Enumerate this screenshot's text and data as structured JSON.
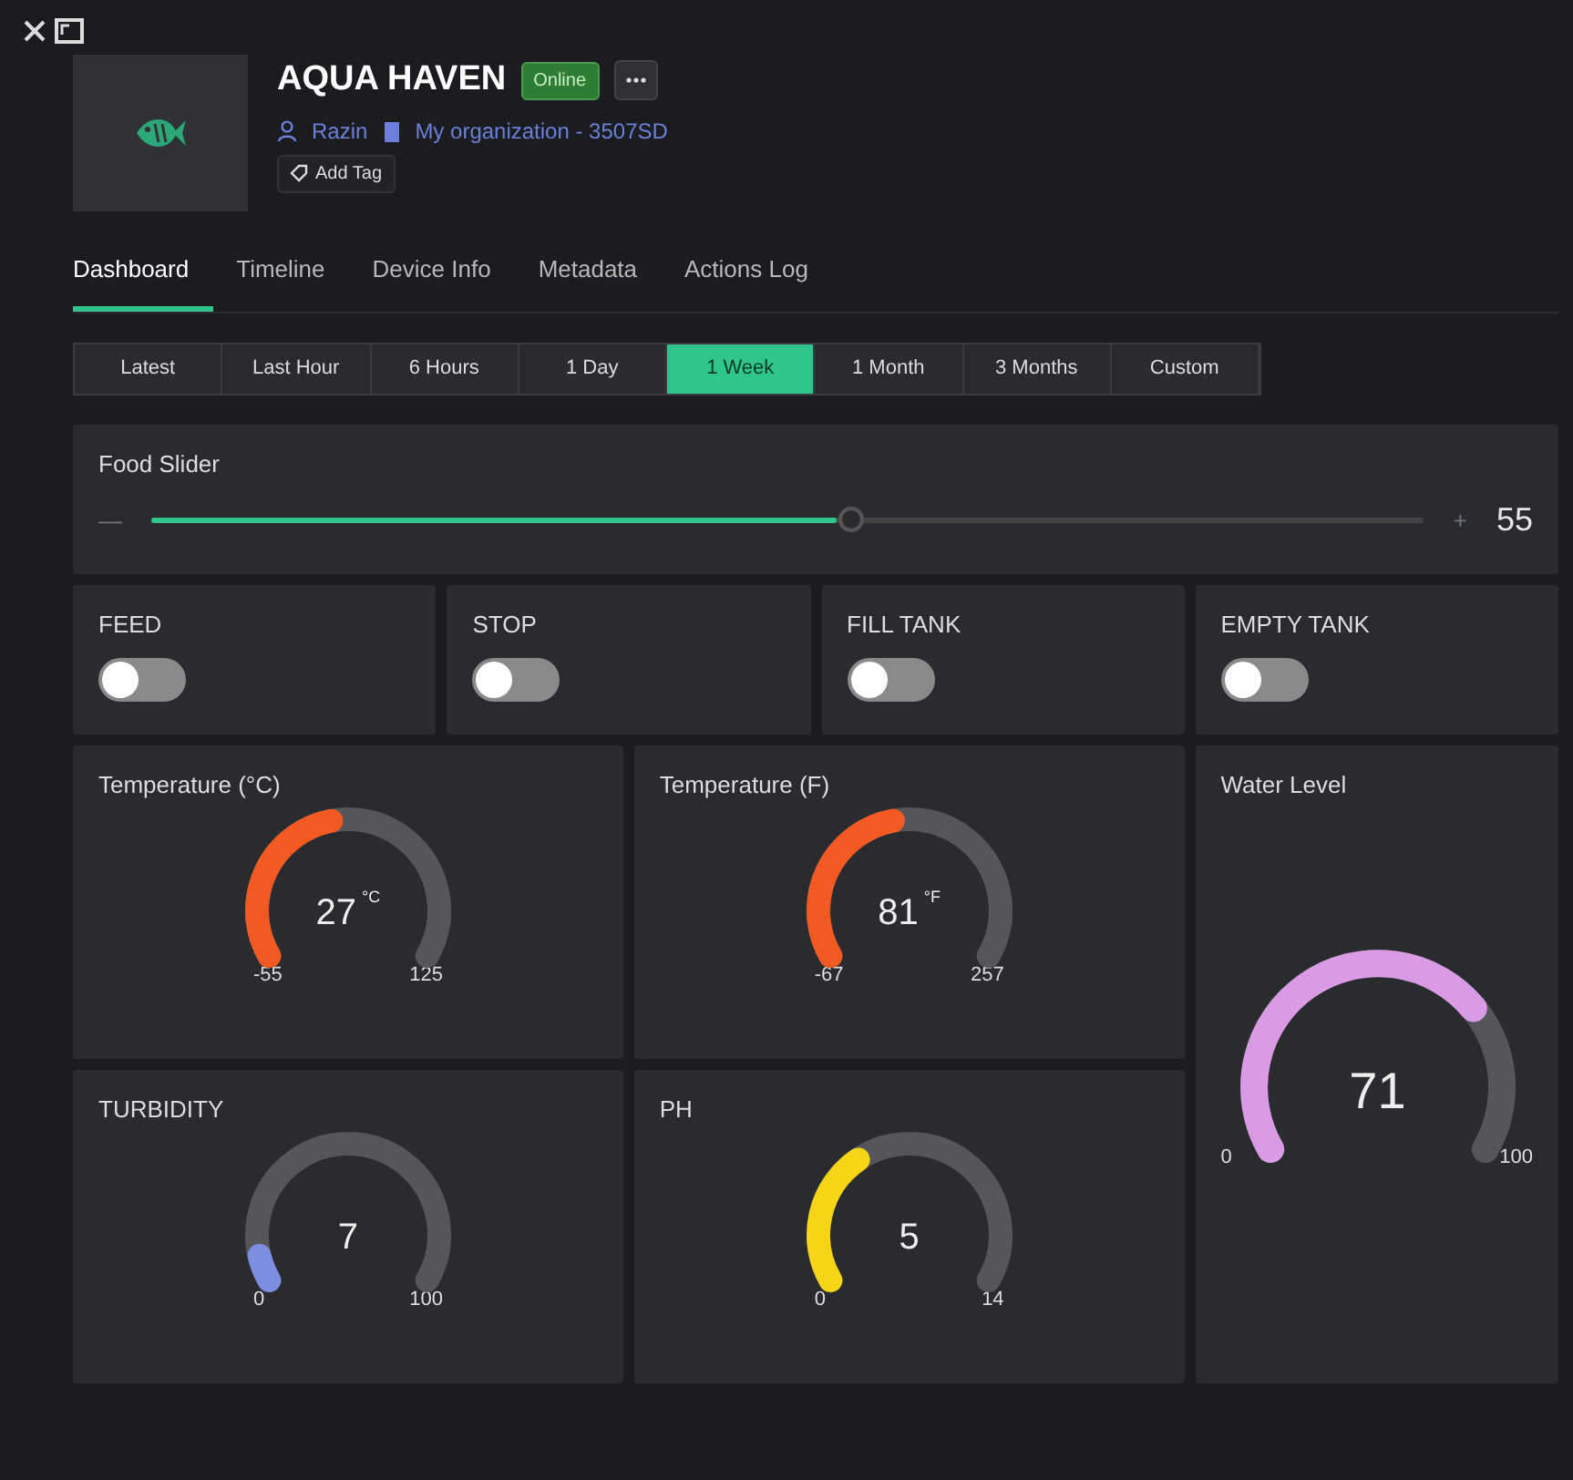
{
  "device": {
    "name": "AQUA HAVEN",
    "status": "Online",
    "owner": "Razin",
    "organization": "My organization - 3507SD",
    "add_tag": "Add Tag"
  },
  "tabs": [
    {
      "label": "Dashboard",
      "selected": true
    },
    {
      "label": "Timeline",
      "selected": false
    },
    {
      "label": "Device Info",
      "selected": false
    },
    {
      "label": "Metadata",
      "selected": false
    },
    {
      "label": "Actions Log",
      "selected": false
    }
  ],
  "time_ranges": [
    {
      "label": "Latest",
      "selected": false
    },
    {
      "label": "Last Hour",
      "selected": false
    },
    {
      "label": "6 Hours",
      "selected": false
    },
    {
      "label": "1 Day",
      "selected": false
    },
    {
      "label": "1 Week",
      "selected": true
    },
    {
      "label": "1 Month",
      "selected": false
    },
    {
      "label": "3 Months",
      "selected": false
    },
    {
      "label": "Custom",
      "selected": false
    }
  ],
  "slider": {
    "title": "Food Slider",
    "minus": "—",
    "plus": "+",
    "level": 0.55,
    "value": "55"
  },
  "switches": [
    {
      "label": "FEED",
      "on": false
    },
    {
      "label": "STOP",
      "on": false
    },
    {
      "label": "FILL TANK",
      "on": false
    },
    {
      "label": "EMPTY TANK",
      "on": false
    }
  ],
  "gauges": [
    {
      "title": "Temperature (°C)",
      "value": "27",
      "unit": "°C",
      "min": "-55",
      "max": "125",
      "color": "#f25a22",
      "kind": "standard"
    },
    {
      "title": "Temperature (F)",
      "value": "81",
      "unit": "°F",
      "min": "-67",
      "max": "257",
      "color": "#f25a22",
      "kind": "standard"
    },
    {
      "title": "Water Level",
      "value": "71",
      "min": "0",
      "max": "100",
      "color": "#d99be3",
      "kind": "tall"
    },
    {
      "title": "TURBIDITY",
      "value": "7",
      "min": "0",
      "max": "100",
      "color": "#7b8ee0",
      "kind": "standard"
    },
    {
      "title": "PH",
      "value": "5",
      "min": "0",
      "max": "14",
      "color": "#f5d516",
      "kind": "standard"
    }
  ]
}
